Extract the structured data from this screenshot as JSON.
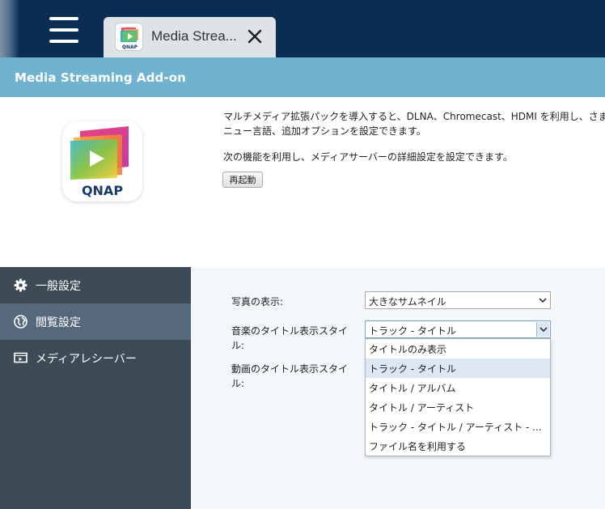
{
  "window": {
    "tab_title": "Media Strea...",
    "tab_icon": "qnap-media-streaming-icon",
    "close_icon": "close-icon",
    "menu_icon": "hamburger-menu-icon"
  },
  "header": {
    "title": "Media Streaming Add-on"
  },
  "info": {
    "logo_text": "QNAP",
    "description_line1": "マルチメディア拡張パックを導入すると、DLNA、Chromecast、HDMI を利用し、さま",
    "description_line2": "ニュー言語、追加オプションを設定できます。",
    "description_line3": "次の機能を利用し、メディアサーバーの詳細設定を設定できます。",
    "restart_label": "再起動"
  },
  "sidebar": {
    "items": [
      {
        "label": "一般設定",
        "icon": "gear-icon",
        "active": false
      },
      {
        "label": "閲覧設定",
        "icon": "globe-icon",
        "active": true
      },
      {
        "label": "メディアレシーバー",
        "icon": "media-receiver-icon",
        "active": false
      }
    ]
  },
  "form": {
    "photo_label": "写真の表示:",
    "photo_value": "大きなサムネイル",
    "music_label_line1": "音楽のタイトル表示スタイ",
    "music_label_line2": "ル:",
    "music_value": "トラック - タイトル",
    "video_label_line1": "動画のタイトル表示スタイ",
    "video_label_line2": "ル:"
  },
  "dropdown": {
    "options": [
      "タイトルのみ表示",
      "トラック - タイトル",
      "タイトル / アルバム",
      "タイトル / アーティスト",
      "トラック - タイトル / アーティスト - ...",
      "ファイル名を利用する"
    ],
    "highlighted_index": 1
  },
  "colors": {
    "topbar": "#0a2d53",
    "header": "#6fb3d1",
    "sidebar": "#3c4b55",
    "sidebar_active": "#56697a",
    "content_bg": "#f4f7fa"
  }
}
